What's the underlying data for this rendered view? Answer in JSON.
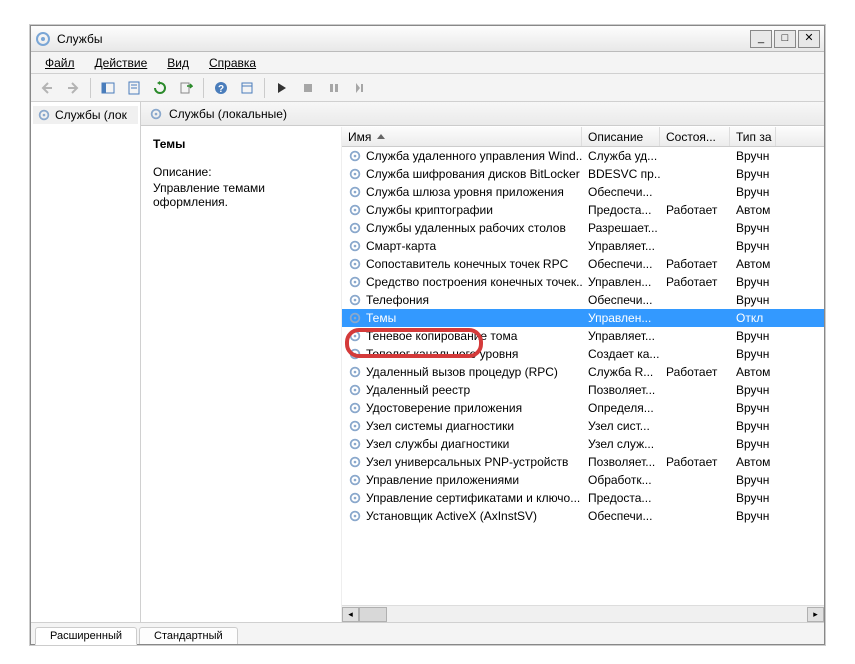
{
  "window": {
    "title": "Службы"
  },
  "menu": {
    "file": "Файл",
    "action": "Действие",
    "view": "Вид",
    "help": "Справка"
  },
  "tree": {
    "item": "Службы (лок"
  },
  "pane": {
    "header": "Службы (локальные)"
  },
  "detail": {
    "title": "Темы",
    "desc_label": "Описание:",
    "desc_text": "Управление темами оформления."
  },
  "columns": [
    "Имя",
    "Описание",
    "Состоя...",
    "Тип за"
  ],
  "rows": [
    {
      "name": "Служба удаленного управления Wind...",
      "desc": "Служба уд...",
      "state": "",
      "type": "Вручн"
    },
    {
      "name": "Служба шифрования дисков BitLocker",
      "desc": "BDESVC пр...",
      "state": "",
      "type": "Вручн"
    },
    {
      "name": "Служба шлюза уровня приложения",
      "desc": "Обеспечи...",
      "state": "",
      "type": "Вручн"
    },
    {
      "name": "Службы криптографии",
      "desc": "Предоста...",
      "state": "Работает",
      "type": "Автом"
    },
    {
      "name": "Службы удаленных рабочих столов",
      "desc": "Разрешает...",
      "state": "",
      "type": "Вручн"
    },
    {
      "name": "Смарт-карта",
      "desc": "Управляет...",
      "state": "",
      "type": "Вручн"
    },
    {
      "name": "Сопоставитель конечных точек RPC",
      "desc": "Обеспечи...",
      "state": "Работает",
      "type": "Автом"
    },
    {
      "name": "Средство построения конечных точек...",
      "desc": "Управлен...",
      "state": "Работает",
      "type": "Вручн"
    },
    {
      "name": "Телефония",
      "desc": "Обеспечи...",
      "state": "",
      "type": "Вручн"
    },
    {
      "name": "Темы",
      "desc": "Управлен...",
      "state": "",
      "type": "Откл",
      "sel": true
    },
    {
      "name": "Теневое копирование тома",
      "desc": "Управляет...",
      "state": "",
      "type": "Вручн"
    },
    {
      "name": "Тополог канального уровня",
      "desc": "Создает ка...",
      "state": "",
      "type": "Вручн"
    },
    {
      "name": "Удаленный вызов процедур (RPC)",
      "desc": "Служба R...",
      "state": "Работает",
      "type": "Автом"
    },
    {
      "name": "Удаленный реестр",
      "desc": "Позволяет...",
      "state": "",
      "type": "Вручн"
    },
    {
      "name": "Удостоверение приложения",
      "desc": "Определя...",
      "state": "",
      "type": "Вручн"
    },
    {
      "name": "Узел системы диагностики",
      "desc": "Узел сист...",
      "state": "",
      "type": "Вручн"
    },
    {
      "name": "Узел службы диагностики",
      "desc": "Узел служ...",
      "state": "",
      "type": "Вручн"
    },
    {
      "name": "Узел универсальных PNP-устройств",
      "desc": "Позволяет...",
      "state": "Работает",
      "type": "Автом"
    },
    {
      "name": "Управление приложениями",
      "desc": "Обработк...",
      "state": "",
      "type": "Вручн"
    },
    {
      "name": "Управление сертификатами и ключо...",
      "desc": "Предоста...",
      "state": "",
      "type": "Вручн"
    },
    {
      "name": "Установщик ActiveX (AxInstSV)",
      "desc": "Обеспечи...",
      "state": "",
      "type": "Вручн"
    }
  ],
  "tabs": {
    "ext": "Расширенный",
    "std": "Стандартный"
  }
}
